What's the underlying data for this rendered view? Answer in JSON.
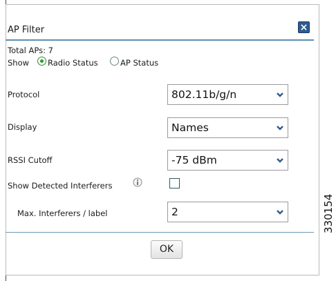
{
  "dialog": {
    "title": "AP Filter",
    "close_icon": "close-icon",
    "total_aps": "Total APs: 7",
    "show_label": "Show",
    "radio_options": [
      {
        "label": "Radio Status",
        "checked": true
      },
      {
        "label": "AP Status",
        "checked": false
      }
    ],
    "fields": [
      {
        "label": "Protocol",
        "value": "802.11b/g/n"
      },
      {
        "label": "Display",
        "value": "Names"
      },
      {
        "label": "RSSI Cutoff",
        "value": "-75 dBm"
      }
    ],
    "show_interferers_label": "Show Detected Interferers",
    "info_icon": "info-icon",
    "show_interferers_checked": false,
    "max_interferers_label": "Max. Interferers / label",
    "max_interferers_value": "2",
    "ok_label": "OK",
    "accent_color": "#2f5b8e"
  },
  "figure_id": "330154"
}
